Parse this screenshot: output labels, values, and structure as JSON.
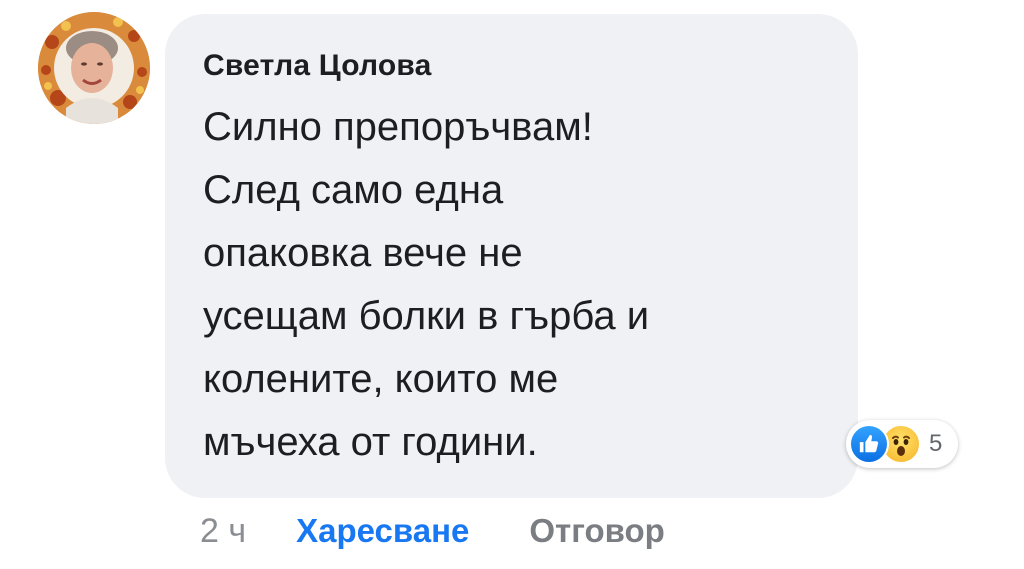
{
  "comment": {
    "author": "Светла Цолова",
    "lines": [
      "Силно препоръчвам!",
      "След само една",
      "опаковка вече не",
      "усещам болки в гърба и",
      "колените, които ме",
      "мъчеха от години."
    ],
    "reactions": {
      "icons": [
        "like-icon",
        "wow-icon"
      ],
      "count": "5",
      "like_color": "#1877f2",
      "wow_color": "#f7b125"
    },
    "time": "2 ч",
    "like_label": "Харесване",
    "reply_label": "Отговор"
  },
  "colors": {
    "bubble": "#eff1f4",
    "text": "#1c1e21",
    "link": "#1877f2",
    "muted": "#8a8d91"
  }
}
